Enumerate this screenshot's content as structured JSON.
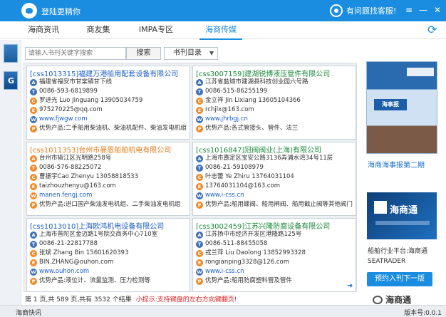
{
  "titlebar": {
    "login": "登陆更精你",
    "help": "有问题找客服!",
    "menu_glyph": "≡",
    "min_glyph": "—",
    "close_glyph": "✕"
  },
  "tabs": [
    "海商资讯",
    "商友集",
    "IMPA专区",
    "海商传媒"
  ],
  "search": {
    "placeholder": "请输入书刊关键字搜索",
    "button": "搜索",
    "select": "书刊目录"
  },
  "cards": [
    {
      "title": "[css1013315]福建万港船用配套设备有限公司",
      "address": "福建省福安市甘棠镇甘下线",
      "phone": "0086-593-6819899",
      "contact": "罗进光 Luo Jinguang 13905034759",
      "email": "975270225@qq.com",
      "web": "www.fjwgw.com",
      "products": "优势产品:二手船用柴油机、柴油机配件、柴油发电机组"
    },
    {
      "title": "[css3007159]建湖锐博液压管件有限公司",
      "address": "江苏省盐城市建湖县科技创业园六号路",
      "phone": "0086-515-86255199",
      "contact": "金立祥 Jin Lixiang 13605104366",
      "email": "rchjlx@163.com",
      "web": "www.jhrbgj.cn",
      "products": "优势产品:各式管接头、管件、法兰"
    },
    {
      "title": "[css1011353]台州市曼恩船舶机电有限公司",
      "address": "台州市椒江区光明路258号",
      "phone": "0086-576-88225072",
      "contact": "曹振宇Cao Zhenyu 13058818533",
      "email": "taizhouzhenyu@163.com",
      "web": "manen.fengj.com",
      "products": "优势产品:进口国产柴油发电机组、二手柴油发电机组"
    },
    {
      "title": "[css1016847]冠阀阀业(上海)有限公司",
      "address": "上海市嘉定区宝安公路3136弄浦水湾34号11层",
      "phone": "0086-21-59108979",
      "contact": "叶志蕾 Ye Zhiru 13764031104",
      "email": "13764031104@163.com",
      "web": "www.i-css.cn",
      "products": "优势产品:船用蝶阀、船用闸阀、船用截止阀等其他阀门"
    },
    {
      "title": "[css1013010]上海欧鸿机电设备有限公司",
      "address": "上海市普陀区金迈路1号院交商务中心710室",
      "phone": "0086-21-22817788",
      "contact": "张斌 Zhang Bin 15601620393",
      "email": "BIN.ZHANG@ouhon.com",
      "web": "www.ouhon.com",
      "products": "优势产品:液位计、流量监测、压力检测等"
    },
    {
      "title": "[css3002459]江苏兴隆防腐设备有限公司",
      "address": "江苏扬中市经济开发区港隆路125号",
      "phone": "0086-511-88455058",
      "contact": "戎兰萍 Liu Daolong 13852993328",
      "email": "rongianping3328@126.com",
      "web": "www.i-css.cn",
      "products": "优势产品:船用防腐塑料管及管件"
    }
  ],
  "pager": {
    "info": "第 1 页,共 589 页,共有 3532 个结果",
    "hint": "小提示:支持键盘的左右方向键翻页!"
  },
  "sidebar": {
    "cover_label": "海事报",
    "cover_caption": "海商海事报第二期",
    "banner_title": "海商通",
    "platform": "船舶行业平台:海商通",
    "seatrader": "SEATRADER",
    "subscribe": "预约入刊下一版"
  },
  "status": {
    "left": "海商快讯",
    "version": "版本号:0.0.1"
  },
  "watermark": "海商通",
  "icons": {
    "address": "A",
    "phone": "T",
    "contact": "C",
    "email": "E",
    "web": "W",
    "products": "P"
  }
}
